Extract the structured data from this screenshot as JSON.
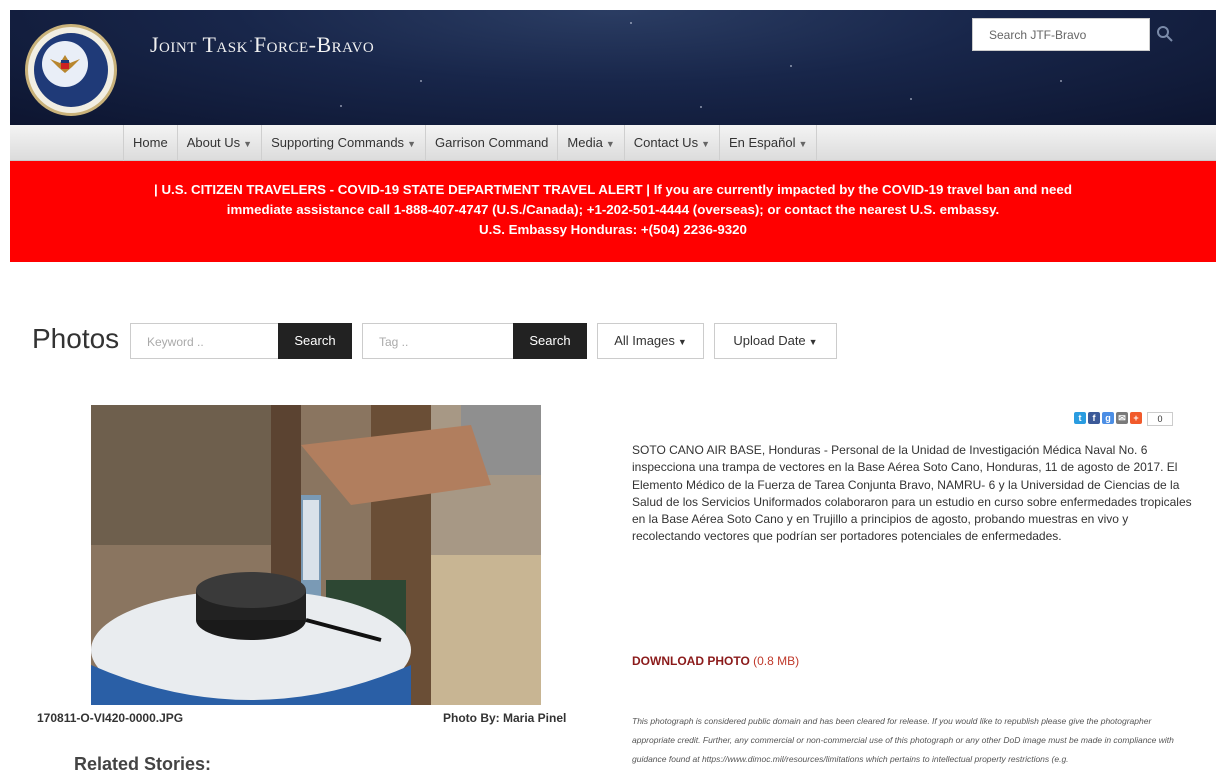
{
  "header": {
    "title": "Joint Task Force-Bravo",
    "search_placeholder": "Search JTF-Bravo"
  },
  "nav": {
    "items": [
      {
        "label": "Home",
        "dropdown": false
      },
      {
        "label": "About Us",
        "dropdown": true
      },
      {
        "label": "Supporting Commands",
        "dropdown": true
      },
      {
        "label": "Garrison Command",
        "dropdown": false
      },
      {
        "label": "Media",
        "dropdown": true
      },
      {
        "label": "Contact Us",
        "dropdown": true
      },
      {
        "label": "En Español",
        "dropdown": true
      }
    ]
  },
  "alert": {
    "line1": "| U.S. CITIZEN TRAVELERS - COVID-19 STATE DEPARTMENT TRAVEL ALERT | If you are currently impacted by the COVID-19 travel ban and need",
    "line2": "immediate assistance call 1-888-407-4747 (U.S./Canada); +1-202-501-4444 (overseas); or contact the nearest U.S. embassy.",
    "line3": "U.S. Embassy Honduras: +(504) 2236-9320"
  },
  "photos": {
    "title": "Photos",
    "keyword_placeholder": "Keyword ..",
    "search_label": "Search",
    "tag_placeholder": "Tag ..",
    "search2_label": "Search",
    "all_images_label": "All Images",
    "upload_date_label": "Upload Date"
  },
  "photo": {
    "filename": "170811-O-VI420-0000.JPG",
    "photo_by": "Photo By: Maria Pinel"
  },
  "share": {
    "count": "0"
  },
  "description": "SOTO CANO AIR BASE, Honduras - Personal de la Unidad de Investigación Médica Naval No. 6 inspecciona una trampa de vectores en la Base Aérea Soto Cano, Honduras, 11 de agosto de 2017. El Elemento Médico de la Fuerza de Tarea Conjunta Bravo, NAMRU- 6 y la Universidad de Ciencias de la Salud de los Servicios Uniformados colaboraron para un estudio en curso sobre enfermedades tropicales en la Base Aérea Soto Cano y en Trujillo a principios de agosto, probando muestras en vivo y recolectando vectores que podrían ser portadores potenciales de enfermedades.",
  "download": {
    "label": "DOWNLOAD PHOTO",
    "size": "(0.8 MB)"
  },
  "disclaimer": "This photograph is considered public domain and has been cleared for release. If you would like to republish please give the photographer appropriate credit. Further, any commercial or non-commercial use of this photograph or any other DoD image must be made in compliance with guidance found at https://www.dimoc.mil/resources/limitations which pertains to intellectual property restrictions (e.g.",
  "related": {
    "title": "Related Stories:"
  }
}
